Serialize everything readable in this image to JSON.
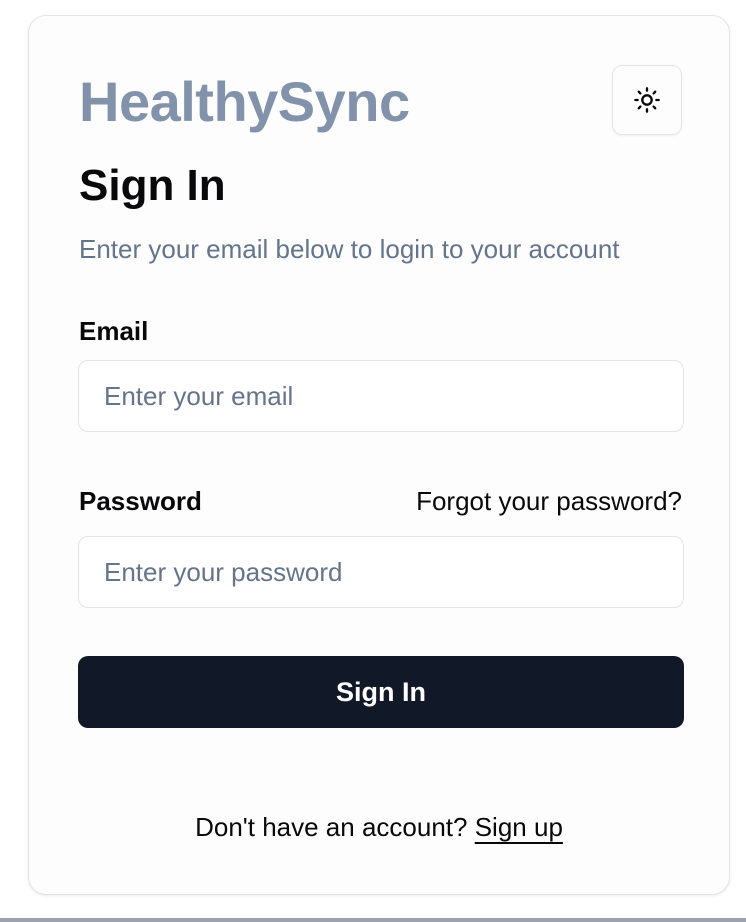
{
  "app": {
    "brand": "HealthySync"
  },
  "header": {
    "theme_toggle_icon": "sun-icon"
  },
  "form": {
    "title": "Sign In",
    "subtitle": "Enter your email below to login to your account",
    "email": {
      "label": "Email",
      "value": "",
      "placeholder": "Enter your email"
    },
    "password": {
      "label": "Password",
      "value": "",
      "placeholder": "Enter your password",
      "forgot_link": "Forgot your password?"
    },
    "submit_label": "Sign In"
  },
  "footer": {
    "prompt": "Don't have an account?",
    "signup_link": "Sign up"
  },
  "colors": {
    "brand": "#8392ab",
    "primary_button": "#111827",
    "muted_text": "#64748b",
    "border": "#e4e4e7"
  }
}
